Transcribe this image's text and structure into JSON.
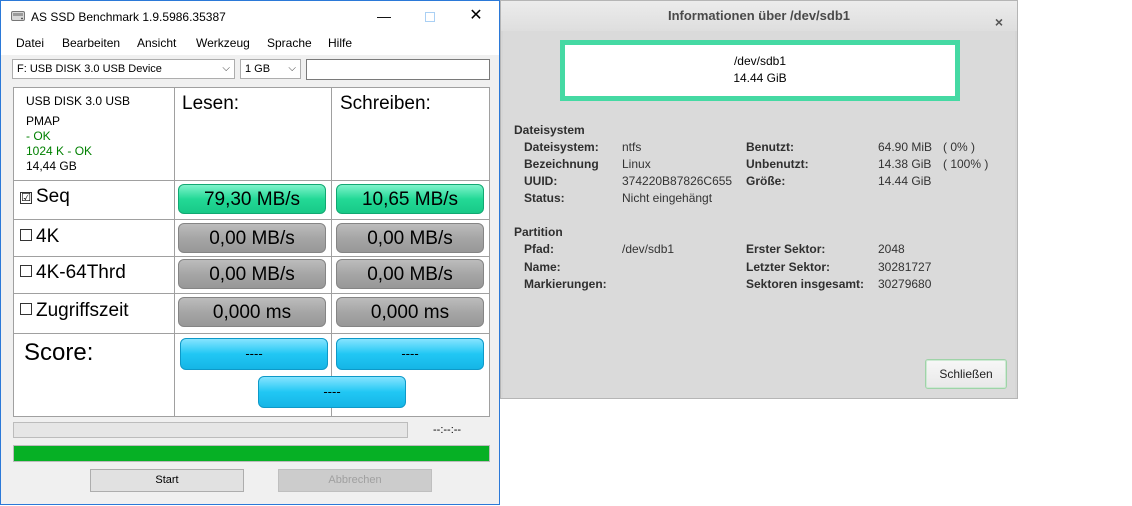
{
  "asssd": {
    "title": "AS SSD Benchmark 1.9.5986.35387",
    "window_controls": {
      "minimize": "—",
      "close": "✕"
    },
    "menu": [
      "Datei",
      "Bearbeiten",
      "Ansicht",
      "Werkzeug",
      "Sprache",
      "Hilfe"
    ],
    "drive_select": "F: USB DISK 3.0 USB Device",
    "size_select": "1 GB",
    "text_field": "",
    "device_info": {
      "name": "USB DISK 3.0 USB",
      "driver": "PMAP",
      "driver_status": " - OK",
      "alignment": "1024 K - OK",
      "capacity": "14,44 GB"
    },
    "headers": {
      "read": "Lesen:",
      "write": "Schreiben:"
    },
    "rows": [
      {
        "check": "☑",
        "label": "Seq",
        "read": "79,30 MB/s",
        "write": "10,65 MB/s"
      },
      {
        "check": "",
        "label": "4K",
        "read": "0,00 MB/s",
        "write": "0,00 MB/s"
      },
      {
        "check": "",
        "label": "4K-64Thrd",
        "read": "0,00 MB/s",
        "write": "0,00 MB/s"
      },
      {
        "check": "",
        "label": "Zugriffszeit",
        "read": "0,000 ms",
        "write": "0,000 ms"
      }
    ],
    "score": {
      "label": "Score:",
      "read": "----",
      "write": "----",
      "total": "----"
    },
    "time": "--:--:--",
    "progress_fraction": 1.0,
    "buttons": {
      "start": "Start",
      "cancel": "Abbrechen"
    },
    "colors": {
      "accent_green": "#23d996",
      "score_blue": "#21c7f4",
      "progress": "#06b025"
    }
  },
  "info": {
    "title": "Informationen über /dev/sdb1",
    "close_icon": "×",
    "device": {
      "path": "/dev/sdb1",
      "size": "14.44 GiB"
    },
    "filesystem": {
      "heading": "Dateisystem",
      "fs_label": "Dateisystem:",
      "fs_value": "ntfs",
      "name_label": "Bezeichnung",
      "name_value": "Linux",
      "uuid_label": "UUID:",
      "uuid_value": "374220B87826C655",
      "status_label": "Status:",
      "status_value": "Nicht eingehängt",
      "used_label": "Benutzt:",
      "used_value": "64.90 MiB",
      "used_pct": "( 0% )",
      "free_label": "Unbenutzt:",
      "free_value": "14.38 GiB",
      "free_pct": "( 100% )",
      "size_label": "Größe:",
      "size_value": "14.44 GiB"
    },
    "partition": {
      "heading": "Partition",
      "path_label": "Pfad:",
      "path_value": "/dev/sdb1",
      "name_label": "Name:",
      "flags_label": "Markierungen:",
      "first_label": "Erster Sektor:",
      "first_value": "2048",
      "last_label": "Letzter Sektor:",
      "last_value": "30281727",
      "total_label": "Sektoren insgesamt:",
      "total_value": "30279680"
    },
    "close_button": "Schließen",
    "colors": {
      "device_border": "#45d9a3"
    }
  }
}
